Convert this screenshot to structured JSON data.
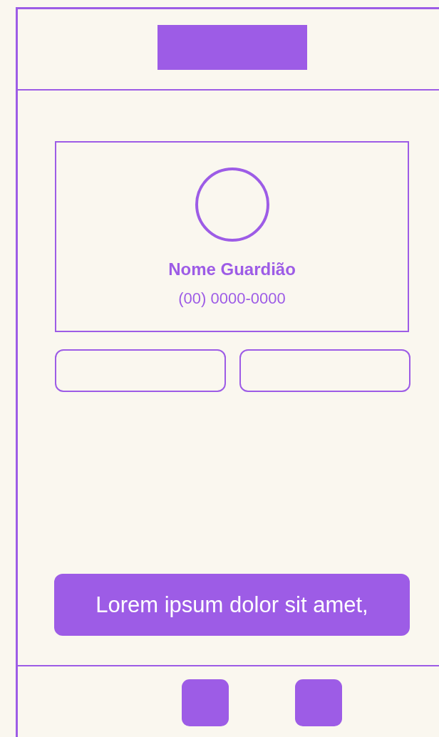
{
  "profile": {
    "name": "Nome Guardião",
    "phone": "(00) 0000-0000"
  },
  "primary_button": {
    "label": "Lorem ipsum dolor sit amet,"
  }
}
